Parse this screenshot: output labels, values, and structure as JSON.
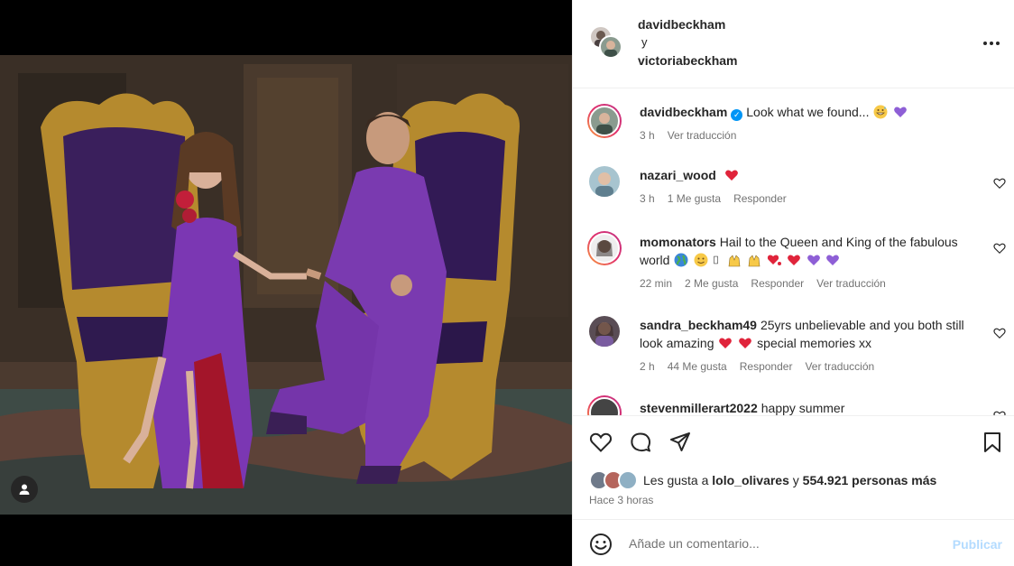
{
  "header": {
    "author1": "davidbeckham",
    "conjunction": "y",
    "author2": "victoriabeckham"
  },
  "caption": {
    "user": "davidbeckham",
    "text": "Look what we found...",
    "emojis": [
      "grinning-sweat-emoji",
      "purple-heart-emoji"
    ],
    "time": "3 h",
    "translate": "Ver traducción"
  },
  "comments": [
    {
      "user": "nazari_wood",
      "text": "",
      "emojis": [
        "red-heart-emoji"
      ],
      "time": "3 h",
      "likes": "1 Me gusta",
      "reply": "Responder",
      "translate": ""
    },
    {
      "user": "momonators",
      "text": "Hail to the Queen and King of the fabulous world",
      "emojis": [
        "globe-emoji",
        "smiley-emoji",
        "placeholder-box",
        "raising-hands-emoji",
        "raising-hands-emoji",
        "heart-exclamation-emoji",
        "red-heart-emoji",
        "purple-heart-emoji",
        "purple-heart-emoji"
      ],
      "time": "22 min",
      "likes": "2 Me gusta",
      "reply": "Responder",
      "translate": "Ver traducción"
    },
    {
      "user": "sandra_beckham49",
      "text": "25yrs unbelievable and you both still look amazing",
      "emojis": [
        "red-heart-emoji",
        "red-heart-emoji"
      ],
      "text_after": "special memories xx",
      "time": "2 h",
      "likes": "44 Me gusta",
      "reply": "Responder",
      "translate": "Ver traducción"
    },
    {
      "user": "stevenmillerart2022",
      "text": "happy summer"
    }
  ],
  "actions": {
    "likes_prefix": "Les gusta a",
    "likes_user": "lolo_olivares",
    "likes_and": "y",
    "likes_count": "554.921 personas más",
    "time_ago": "Hace 3 horas"
  },
  "add_comment": {
    "placeholder": "Añade un comentario...",
    "post_label": "Publicar"
  },
  "colors": {
    "accent": "#0095f6",
    "post_disabled": "#b3dbff",
    "heart": "#ed4956",
    "purple_heart": "#8e5fd6"
  }
}
